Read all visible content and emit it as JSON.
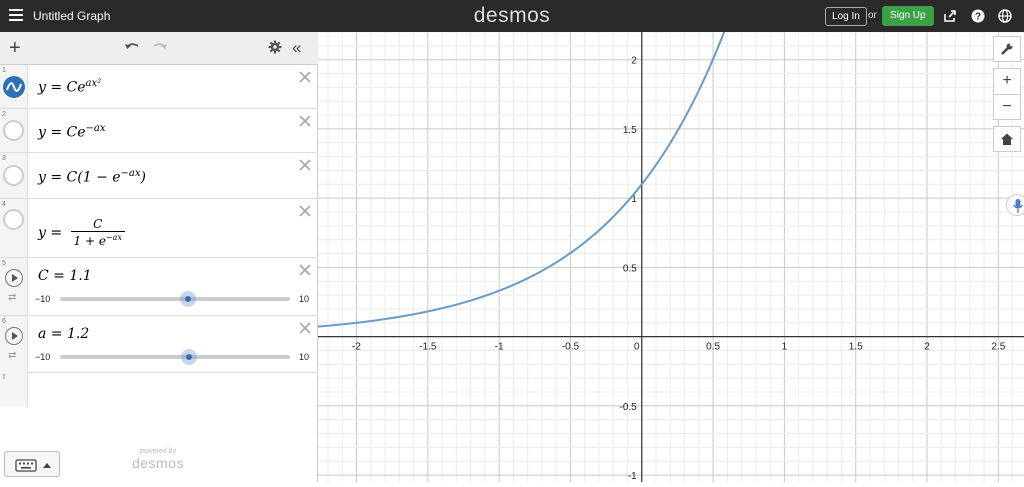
{
  "app": {
    "title": "Untitled Graph",
    "brand": "desmos",
    "login_label": "Log In",
    "or_label": "or",
    "signup_label": "Sign Up"
  },
  "colors": {
    "topbar": "#2a2a2a",
    "signup": "#3ba046",
    "curve": "#6a9ac9",
    "slider_accent": "#3c6ab8"
  },
  "expressions": [
    {
      "num": "1",
      "type": "function",
      "latex_lhs": "y = Ce",
      "exp": "ax²",
      "visible": true,
      "color_icon": "desmos-wave-icon"
    },
    {
      "num": "2",
      "type": "function",
      "text": "y = Ce",
      "exp": "−ax",
      "visible": false
    },
    {
      "num": "3",
      "type": "function",
      "text_a": "y = C(1 − e",
      "exp": "−ax",
      "text_b": ")",
      "visible": false
    },
    {
      "num": "4",
      "type": "function",
      "lhs": "y =",
      "numerator": "C",
      "denominator": "1 + e",
      "den_exp": "−ax",
      "visible": false
    },
    {
      "num": "5",
      "type": "slider",
      "text": "C = 1.1",
      "variable": "C",
      "value": 1.1,
      "min": "−10",
      "max": "10"
    },
    {
      "num": "6",
      "type": "slider",
      "text": "a = 1.2",
      "variable": "a",
      "value": 1.2,
      "min": "−10",
      "max": "10"
    },
    {
      "num": "7",
      "type": "empty"
    }
  ],
  "powered_by": "powered by",
  "powered_brand": "desmos",
  "graph": {
    "x_ticks": [
      "-2",
      "-1.5",
      "-1",
      "-0.5",
      "0",
      "0.5",
      "1",
      "1.5",
      "2",
      "2.5"
    ],
    "y_ticks": [
      "2",
      "1.5",
      "1",
      "0.5",
      "-0.5",
      "-1"
    ],
    "xlim": [
      -2.27,
      2.68
    ],
    "ylim": [
      -1.05,
      2.2
    ],
    "curve": {
      "function": "y = 1.1 * exp(1.2 * x)",
      "C": 1.1,
      "a": 1.2
    }
  }
}
